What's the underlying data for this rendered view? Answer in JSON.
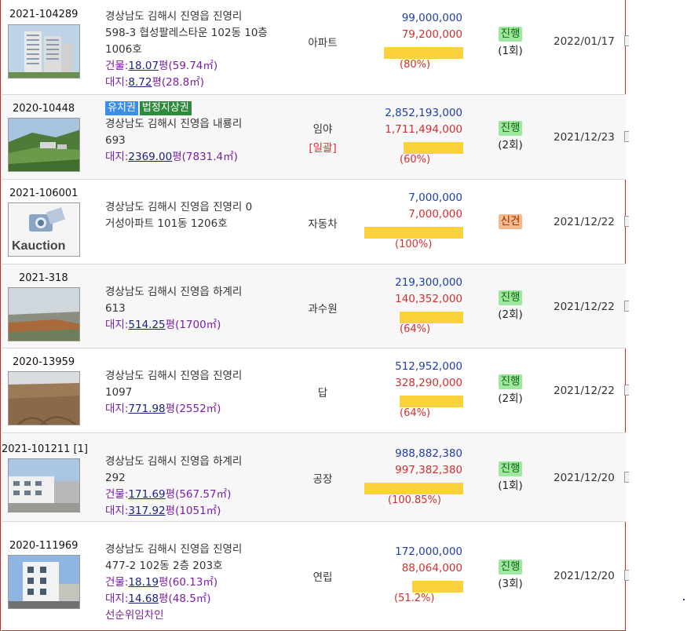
{
  "rows": [
    {
      "case_no": "2021-104289",
      "address": [
        "경상남도 김해시 진영읍 진영리",
        "598-3 협성팔레스타운 102동 10층",
        "1006호"
      ],
      "building": {
        "label": "건물:",
        "pyeong": "18.07",
        "unit": "평",
        "sqm": "(59.74㎡)"
      },
      "land": {
        "label": "대지:",
        "pyeong": "8.72",
        "unit": "평",
        "sqm": "(28.8㎡)"
      },
      "type": "아파트",
      "appraisal": "99,000,000",
      "minimum": "79,200,000",
      "ratio": 0.8,
      "percent": "(80%)",
      "status": "진행",
      "round": "(1회)",
      "date": "2022/01/17"
    },
    {
      "case_no": "2020-10448",
      "tags": [
        "유치권",
        "법정지상권"
      ],
      "address": [
        "경상남도 김해시 진영읍 내룡리",
        "693"
      ],
      "land": {
        "label": "대지:",
        "pyeong": "2369.00",
        "unit": "평",
        "sqm": "(7831.4㎡)"
      },
      "type": "임야",
      "type_sub": "[일괄]",
      "appraisal": "2,852,193,000",
      "minimum": "1,711,494,000",
      "ratio": 0.6,
      "percent": "(60%)",
      "status": "진행",
      "round": "(2회)",
      "date": "2021/12/23"
    },
    {
      "case_no": "2021-106001",
      "address": [
        "경상남도 김해시 진영읍 진영리 0",
        "거성아파트 101동 1206호"
      ],
      "type": "자동차",
      "appraisal": "7,000,000",
      "minimum": "7,000,000",
      "ratio": 1.0,
      "percent": "(100%)",
      "status": "신건",
      "date": "2021/12/22",
      "logo_text": "Kauction"
    },
    {
      "case_no": "2021-318",
      "address": [
        "경상남도 김해시 진영읍 하계리",
        "613"
      ],
      "land": {
        "label": "대지:",
        "pyeong": "514.25",
        "unit": "평",
        "sqm": "(1700㎡)"
      },
      "type": "과수원",
      "appraisal": "219,300,000",
      "minimum": "140,352,000",
      "ratio": 0.64,
      "percent": "(64%)",
      "status": "진행",
      "round": "(2회)",
      "date": "2021/12/22"
    },
    {
      "case_no": "2020-13959",
      "address": [
        "경상남도 김해시 진영읍 진영리",
        "1097"
      ],
      "land": {
        "label": "대지:",
        "pyeong": "771.98",
        "unit": "평",
        "sqm": "(2552㎡)"
      },
      "type": "답",
      "appraisal": "512,952,000",
      "minimum": "328,290,000",
      "ratio": 0.64,
      "percent": "(64%)",
      "status": "진행",
      "round": "(2회)",
      "date": "2021/12/22"
    },
    {
      "case_no": "2021-101211 [1]",
      "address": [
        "경상남도 김해시 진영읍 하계리",
        "292"
      ],
      "building": {
        "label": "건물:",
        "pyeong": "171.69",
        "unit": "평",
        "sqm": "(567.57㎡)"
      },
      "land": {
        "label": "대지:",
        "pyeong": "317.92",
        "unit": "평",
        "sqm": "(1051㎡)"
      },
      "type": "공장",
      "appraisal": "988,882,380",
      "minimum": "997,382,380",
      "ratio": 1.0085,
      "percent": "(100.85%)",
      "status": "진행",
      "round": "(1회)",
      "date": "2021/12/20"
    },
    {
      "case_no": "2020-111969",
      "address": [
        "경상남도 김해시 진영읍 진영리",
        "477-2 102동 2층 203호"
      ],
      "building": {
        "label": "건물:",
        "pyeong": "18.19",
        "unit": "평",
        "sqm": "(60.13㎡)"
      },
      "land": {
        "label": "대지:",
        "pyeong": "14.68",
        "unit": "평",
        "sqm": "(48.5㎡)"
      },
      "tenant": "선순위임차인",
      "type": "연립",
      "appraisal": "172,000,000",
      "minimum": "88,064,000",
      "ratio": 0.512,
      "percent": "(51.2%)",
      "status": "진행",
      "round": "(3회)",
      "date": "2021/12/20"
    }
  ],
  "colors": {
    "appraisal": "#1e3ea8",
    "minimum": "#d32f2f",
    "bar": "#fad23c",
    "status_progress": "#9ee79e",
    "status_new": "#f6b98b"
  }
}
